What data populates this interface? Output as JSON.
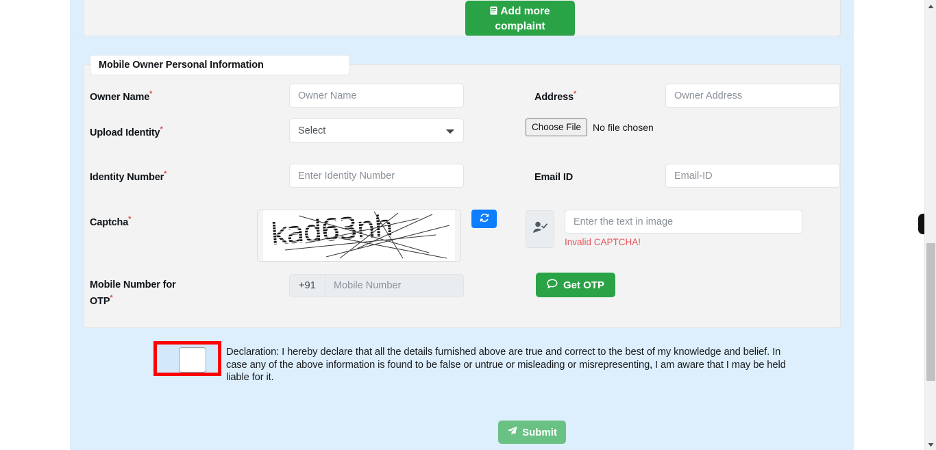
{
  "top_panel": {
    "add_more_button": {
      "line1": "Add more",
      "line2": "complaint",
      "icon": "document-icon",
      "color": "#2aa346"
    }
  },
  "fieldset": {
    "legend": "Mobile Owner Personal Information"
  },
  "fields": {
    "owner_name": {
      "label": "Owner Name",
      "required_mark": "*",
      "placeholder": "Owner Name",
      "value": ""
    },
    "address": {
      "label": "Address",
      "required_mark": "*",
      "placeholder": "Owner Address",
      "value": ""
    },
    "upload_identity": {
      "label": "Upload Identity",
      "required_mark": "*",
      "selected_option": "Select",
      "options": [
        "Select"
      ]
    },
    "file_upload": {
      "button_label": "Choose File",
      "status_text": "No file chosen"
    },
    "identity_number": {
      "label": "Identity Number",
      "required_mark": "*",
      "placeholder": "Enter Identity Number",
      "value": ""
    },
    "email_id": {
      "label": "Email ID",
      "required_mark": "",
      "placeholder": "Email-ID",
      "value": ""
    },
    "captcha": {
      "label": "Captcha",
      "required_mark": "*",
      "image_text": "kad63nh",
      "refresh_icon": "refresh-icon",
      "refresh_button_color": "#0d7efd",
      "user_icon": "user-check-icon",
      "input_placeholder": "Enter the text in image",
      "input_value": "",
      "error_message": "Invalid CAPTCHA!",
      "error_color": "#e2575c"
    },
    "mobile_otp": {
      "label_line1": "Mobile Number for",
      "label_line2": "OTP",
      "required_mark": "*",
      "country_prefix": "+91",
      "placeholder": "Mobile Number",
      "value": "",
      "otp_button_label": "Get OTP",
      "otp_button_icon": "chat-bubble-icon",
      "otp_button_color": "#2aa346"
    }
  },
  "declaration": {
    "checkbox_checked": false,
    "highlight_color": "#fe0000",
    "text": "Declaration: I hereby declare that all the details furnished above are true and correct to the best of my knowledge and belief. In case any of the above information is found to be false or untrue or misleading or misrepresenting, I am aware that I may be held liable for it."
  },
  "submit": {
    "label": "Submit",
    "icon": "paper-plane-icon",
    "color": "#69c184"
  },
  "scrollbar": {
    "up_arrow_icon": "chevron-up-icon",
    "down_arrow_icon": "chevron-down-icon"
  }
}
